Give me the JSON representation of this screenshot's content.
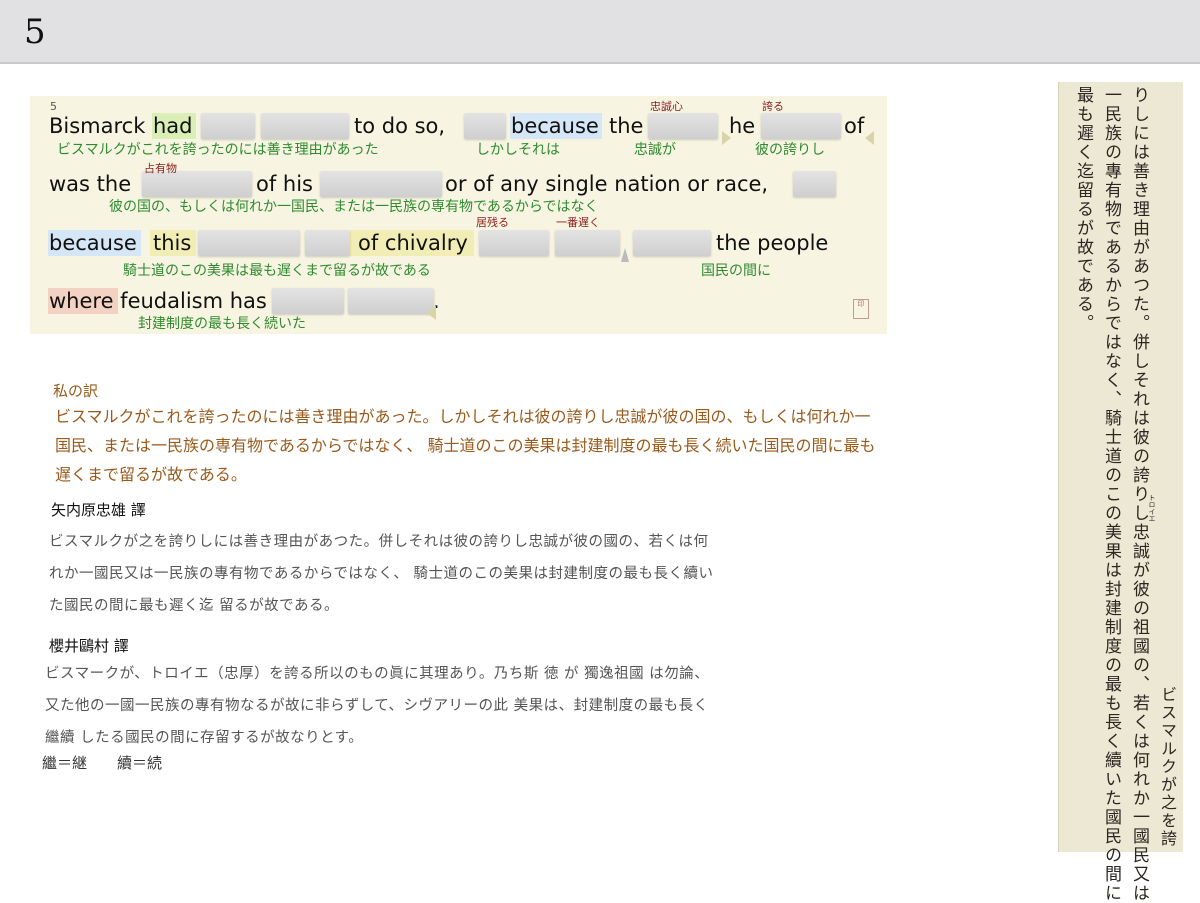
{
  "page_number": "5",
  "exercise": {
    "line_number": "5",
    "line1_words": {
      "bismarck": "Bismarck",
      "had": "had",
      "to_do_so": "to do so,",
      "because": "because",
      "the": "the",
      "he": "he",
      "of": "of"
    },
    "line2_words": {
      "was_the": "was the",
      "of_his": "of his",
      "or_of": "or of any single nation or race,"
    },
    "line3_words": {
      "because": "because",
      "this": "this",
      "of_chivalry": "of chivalry",
      "the_people": "the people"
    },
    "line4_words": {
      "where_feudalism": "where feudalism has",
      "period": "."
    },
    "glosses": {
      "g1": "ビスマルクがこれを誇ったのには善き理由があった",
      "g2": "しかしそれは",
      "g3": "忠誠が",
      "g4": "彼の誇りし",
      "g5": "彼の国の、もしくは何れか一国民、または一民族の専有物であるからではなく",
      "g6": "騎士道のこの美果は最も遅くまで留るが故である",
      "g7": "国民の間に",
      "g8": "封建制度の最も長く続いた"
    },
    "ruby": {
      "r1": "忠誠心",
      "r2": "誇る",
      "r3": "占有物",
      "r4": "居残る",
      "r5": "一番遅く"
    },
    "stamp_text": "印"
  },
  "my_translation": {
    "heading": "私の訳",
    "text": "ビスマルクがこれを誇ったのには善き理由があった。しかしそれは彼の誇りし忠誠が彼の国の、もしくは何れか一国民、または一民族の専有物であるからではなく、 騎士道のこの美果は封建制度の最も長く続いた国民の間に最も遅くまで留るが故である。"
  },
  "translation_yanaihara": {
    "heading": "矢内原忠雄 譯",
    "lines": [
      "ビスマルクが之を誇りしには善き理由があつた。併しそれは彼の誇りし忠誠が彼の國の、若くは何",
      "れか一國民又は一民族の專有物であるからではなく、 騎士道のこの美果は封建制度の最も長く續い",
      "た國民の間に最も遲く迄 留るが故である。"
    ]
  },
  "translation_sakurai": {
    "heading": "櫻井鷗村 譯",
    "lines": [
      "ビスマークが、トロイエ（忠厚）を誇る所以のもの眞に其理あり。乃ち斯 徳 が 獨逸祖國 は勿論、",
      "又た他の一國一民族の專有物なるが故に非らずして、シヴアリーの此 美果は、封建制度の最も長く",
      "繼續 したる國民の間に存留するが故なりとす。"
    ]
  },
  "kanji_note": "繼＝継　　續＝続",
  "scan_columns": [
    "ビスマルクが之を誇",
    "りしには善き理由があつた。併しそれは彼の誇りし忠誠が彼の祖國の、若くは何れか一國民又は",
    "一民族の專有物であるからではなく、騎士道のこの美果は封建制度の最も長く續いた國民の間に",
    "最も遲く迄留るが故である。"
  ],
  "scan_ruby": "トロイエ"
}
